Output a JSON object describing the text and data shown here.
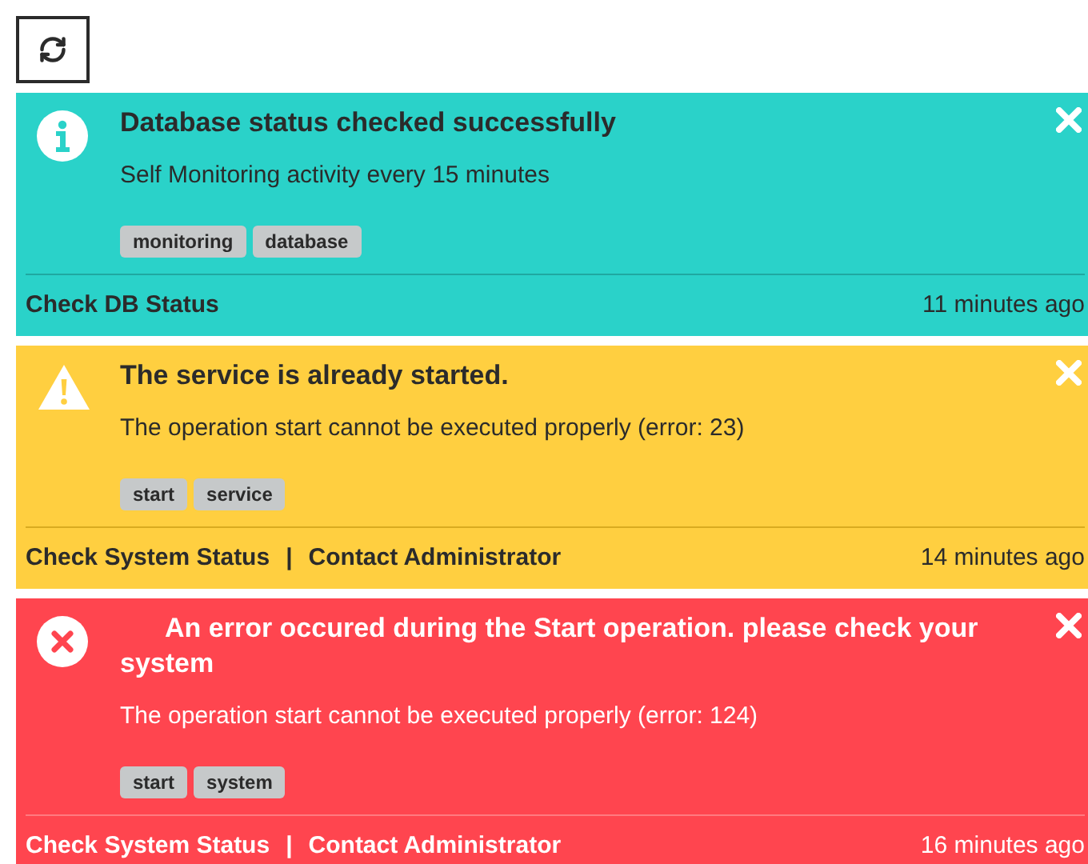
{
  "alerts": [
    {
      "kind": "info",
      "title": "Database status checked successfully",
      "message": "Self Monitoring activity every 15 minutes",
      "tags": [
        "monitoring",
        "database"
      ],
      "links": [
        "Check DB Status"
      ],
      "time": "11 minutes ago"
    },
    {
      "kind": "warning",
      "title": "The service is already started.",
      "message": "The operation start cannot be executed properly (error: 23)",
      "tags": [
        "start",
        "service"
      ],
      "links": [
        "Check System Status",
        "Contact Administrator"
      ],
      "separator": "|",
      "time": "14 minutes ago"
    },
    {
      "kind": "error",
      "title": "An error occured during the Start operation. please check your system",
      "message": "The operation start cannot be executed properly (error: 124)",
      "tags": [
        "start",
        "system"
      ],
      "links": [
        "Check System Status",
        "Contact Administrator"
      ],
      "separator": "|",
      "time": "16 minutes ago"
    }
  ]
}
